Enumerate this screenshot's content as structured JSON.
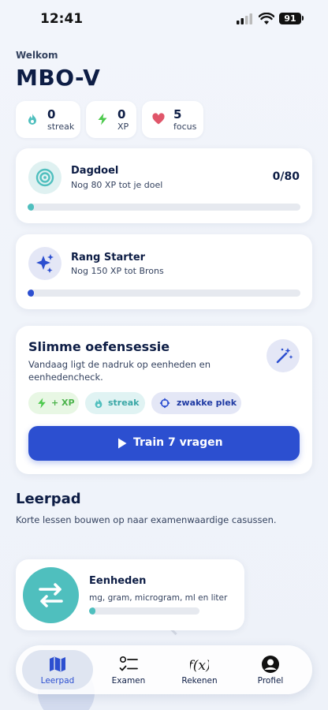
{
  "status": {
    "time": "12:41",
    "battery": "91"
  },
  "header": {
    "welcome": "Welkom",
    "title": "MBO-V"
  },
  "stats": [
    {
      "value": "0",
      "label": "streak",
      "icon": "flame-icon"
    },
    {
      "value": "0",
      "label": "XP",
      "icon": "lightning-icon"
    },
    {
      "value": "5",
      "label": "focus",
      "icon": "heart-icon"
    }
  ],
  "daily_goal": {
    "title": "Dagdoel",
    "subtitle": "Nog 80 XP tot je doel",
    "score": "0/80",
    "progress": 0.02
  },
  "rank": {
    "title": "Rang Starter",
    "subtitle": "Nog 150 XP tot Brons",
    "progress": 0.02
  },
  "session": {
    "title": "Slimme oefensessie",
    "line1": "Vandaag ligt de nadruk op eenheden en",
    "line2": "eenhedencheck.",
    "chips": [
      "+ XP",
      "streak",
      "zwakke plek"
    ],
    "button": "Train 7 vragen"
  },
  "learning_path": {
    "title": "Leerpad",
    "subtitle": "Korte lessen bouwen op naar examenwaardige casussen.",
    "lesson": {
      "title": "Eenheden",
      "subtitle": "mg, gram, microgram, ml en liter",
      "progress": 0.05
    }
  },
  "tabs": [
    {
      "label": "Leerpad",
      "icon": "map-icon",
      "active": true
    },
    {
      "label": "Examen",
      "icon": "checklist-icon",
      "active": false
    },
    {
      "label": "Rekenen",
      "icon": "function-icon",
      "active": false
    },
    {
      "label": "Profiel",
      "icon": "profile-icon",
      "active": false
    }
  ],
  "colors": {
    "primary": "#2c4fd0",
    "teal": "#4fbfbe",
    "green": "#4cc94c",
    "heart": "#e0566a"
  }
}
